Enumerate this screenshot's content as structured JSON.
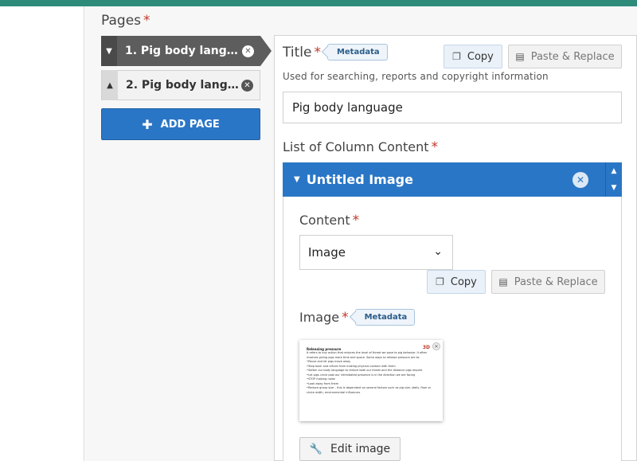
{
  "pages_section": {
    "label": "Pages",
    "required_mark": "*",
    "items": [
      {
        "label": "1. Pig body language",
        "handle_icon": "chevron-down",
        "active": true
      },
      {
        "label": "2. Pig body langua...",
        "handle_icon": "chevron-up",
        "active": false
      }
    ],
    "add_label": "ADD PAGE"
  },
  "title_field": {
    "label": "Title",
    "required_mark": "*",
    "metadata_tag": "Metadata",
    "copy_label": "Copy",
    "paste_label": "Paste & Replace",
    "helper": "Used for searching, reports and copyright information",
    "value": "Pig body language"
  },
  "column_content": {
    "label": "List of Column Content",
    "required_mark": "*",
    "item_title": "Untitled Image",
    "content_label": "Content",
    "content_required": "*",
    "content_selected": "Image",
    "copy_label": "Copy",
    "paste_label": "Paste & Replace",
    "image_label": "Image",
    "image_required": "*",
    "image_metadata_tag": "Metadata",
    "thumbnail": {
      "title": "Releasing pressure",
      "logo": "3D",
      "lines": [
        "It refers to any action that reduces the level of threat we pose to pig behavior. It often",
        "involves giving pigs more time and space. Some ways to release pressure are to:",
        "•Pause and let pigs move away",
        "•Step back and refrain from making physical contact with them",
        "•Soften our body language to reduce both our threat and the distance pigs require",
        "•Let pigs circle past our intimidated presence is in the direction we are facing",
        "•STOP making noise",
        "•Look away from them",
        "•Reduce group size – this is dependent on several factors such as pig size, stalls, floor or",
        "  chute width, environmental influences"
      ]
    },
    "edit_label": "Edit image"
  },
  "colors": {
    "accent_blue": "#2a76c6",
    "top_bar": "#2e8b7a",
    "required": "#c0392b"
  }
}
